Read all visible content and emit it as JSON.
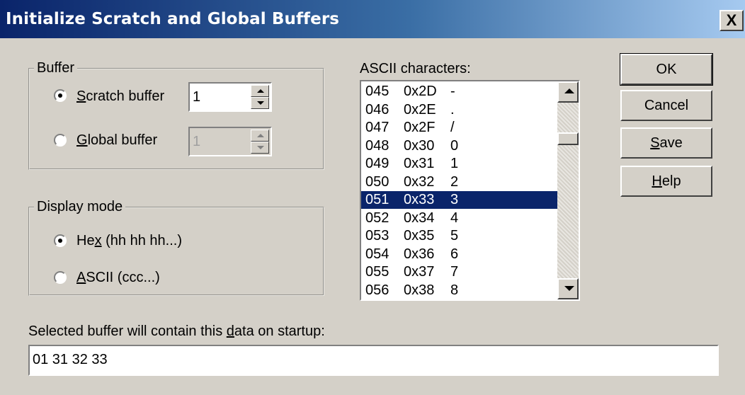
{
  "window": {
    "title": "Initialize Scratch and Global Buffers",
    "close_label": "X"
  },
  "buffer_group": {
    "legend": "Buffer",
    "scratch_label_u": "S",
    "scratch_label_rest": "cratch buffer",
    "scratch_value": "1",
    "global_label_u": "G",
    "global_label_rest": "lobal buffer",
    "global_value": "1",
    "selected": "scratch"
  },
  "display_group": {
    "legend": "Display mode",
    "hex_label_pre": "He",
    "hex_label_u": "x",
    "hex_label_post": " (hh hh hh...)",
    "ascii_label_u": "A",
    "ascii_label_rest": "SCII (ccc...)",
    "selected": "hex"
  },
  "ascii_list": {
    "label": "ASCII characters:",
    "rows": [
      {
        "dec": "045",
        "hex": "0x2D",
        "ch": "-"
      },
      {
        "dec": "046",
        "hex": "0x2E",
        "ch": "."
      },
      {
        "dec": "047",
        "hex": "0x2F",
        "ch": "/"
      },
      {
        "dec": "048",
        "hex": "0x30",
        "ch": "0"
      },
      {
        "dec": "049",
        "hex": "0x31",
        "ch": "1"
      },
      {
        "dec": "050",
        "hex": "0x32",
        "ch": "2"
      },
      {
        "dec": "051",
        "hex": "0x33",
        "ch": "3"
      },
      {
        "dec": "052",
        "hex": "0x34",
        "ch": "4"
      },
      {
        "dec": "053",
        "hex": "0x35",
        "ch": "5"
      },
      {
        "dec": "054",
        "hex": "0x36",
        "ch": "6"
      },
      {
        "dec": "055",
        "hex": "0x37",
        "ch": "7"
      },
      {
        "dec": "056",
        "hex": "0x38",
        "ch": "8"
      }
    ],
    "selected_index": 6
  },
  "buttons": {
    "ok": "OK",
    "cancel": "Cancel",
    "save_u": "S",
    "save_rest": "ave",
    "help_u": "H",
    "help_rest": "elp"
  },
  "startup": {
    "label_pre": "Selected buffer will contain this ",
    "label_u": "d",
    "label_post": "ata on startup:",
    "value": "01 31 32 33"
  }
}
